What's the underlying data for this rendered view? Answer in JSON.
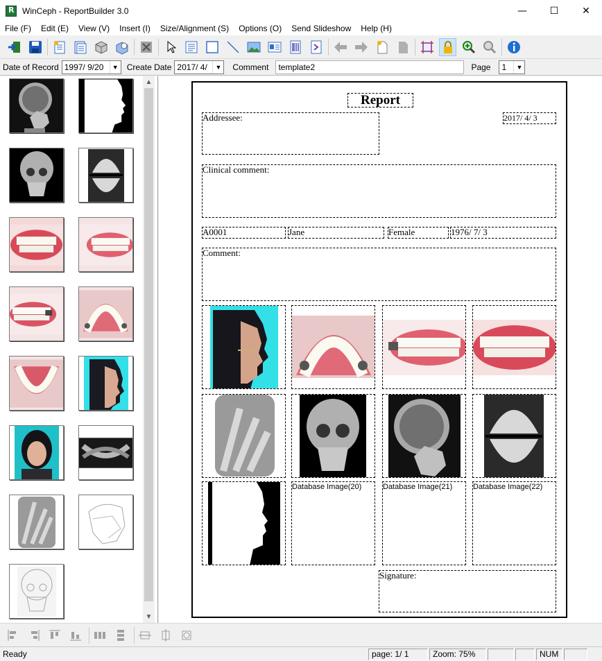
{
  "window": {
    "title": "WinCeph - ReportBuilder 3.0",
    "minimize": "—",
    "maximize": "☐",
    "close": "✕"
  },
  "menu": [
    "File (F)",
    "Edit (E)",
    "View (V)",
    "Insert (I)",
    "Size/Alignment (S)",
    "Options (O)",
    "Send Slideshow",
    "Help (H)"
  ],
  "toolbar": {
    "icons": [
      "exit-icon",
      "save-icon",
      "new-report-icon",
      "template-icon",
      "box-icon",
      "import-icon",
      "delete-icon",
      "pointer-icon",
      "text-box-icon",
      "rectangle-icon",
      "line-icon",
      "image-icon",
      "id-card-icon",
      "barcode-icon",
      "send-icon",
      "arrow-left-icon",
      "arrow-right-icon",
      "new-page-icon",
      "page-icon",
      "crop-icon",
      "lock-icon",
      "zoom-in-icon",
      "zoom-out-icon",
      "info-icon"
    ]
  },
  "fields": {
    "date_of_record_label": "Date of Record",
    "date_of_record_value": "1997/ 9/20",
    "create_date_label": "Create Date",
    "create_date_value": "2017/ 4/",
    "comment_label": "Comment",
    "comment_value": "template2",
    "page_label": "Page",
    "page_value": "1"
  },
  "thumbnails": [
    "skull-lateral-xray",
    "silhouette-profile",
    "skull-frontal-xray",
    "dental-model-occlusal",
    "teeth-frontal-photo",
    "teeth-right-photo",
    "teeth-left-photo",
    "upper-arch-photo",
    "lower-arch-photo",
    "face-profile-photo",
    "face-frontal-photo",
    "panoramic-xray",
    "hand-wrist-xray",
    "ceph-tracing",
    "skull-tracing"
  ],
  "report": {
    "title": "Report",
    "addressee_label": "Addressee:",
    "date": "2017/ 4/ 3",
    "clinical_comment_label": "Clinical comment:",
    "patient_id": "A0001",
    "patient_name": "Jane",
    "patient_sex": "Female",
    "patient_dob": "1976/ 7/ 3",
    "comment_label": "Comment:",
    "db_image_20": "Database Image(20)",
    "db_image_21": "Database Image(21)",
    "db_image_22": "Database Image(22)",
    "signature_label": "Signature:"
  },
  "align_toolbar": {
    "icons": [
      "align-left-icon",
      "align-right-icon",
      "align-top-icon",
      "align-bottom-icon",
      "space-horizontal-icon",
      "space-vertical-icon",
      "same-width-icon",
      "same-height-icon",
      "same-size-icon"
    ]
  },
  "status": {
    "ready": "Ready",
    "page": "page:  1/  1",
    "zoom": "Zoom: 75%",
    "num": "NUM"
  }
}
